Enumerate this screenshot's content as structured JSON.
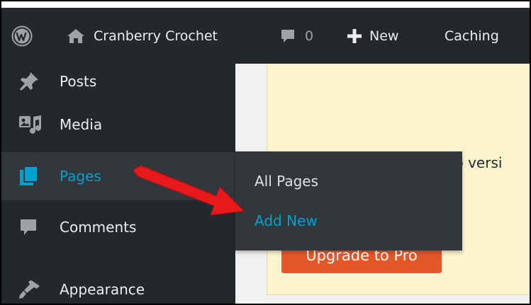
{
  "adminbar": {
    "site_name": "Cranberry Crochet",
    "comments_count": "0",
    "new_label": "New",
    "caching_label": "Caching"
  },
  "sidebar": {
    "items": [
      {
        "label": "Posts",
        "icon": "pin-icon"
      },
      {
        "label": "Media",
        "icon": "media-icon"
      },
      {
        "label": "Pages",
        "icon": "pages-icon",
        "active": true
      },
      {
        "label": "Comments",
        "icon": "comment-icon"
      },
      {
        "label": "Appearance",
        "icon": "brush-icon"
      }
    ]
  },
  "flyout": {
    "items": [
      {
        "label": "All Pages"
      },
      {
        "label": "Add New",
        "highlighted": true
      }
    ]
  },
  "notice": {
    "text": "Pro versi",
    "button_label": "Upgrade to Pro"
  },
  "colors": {
    "adminbar_bg": "#23282d",
    "submenu_bg": "#32373c",
    "link_blue": "#00a0d2",
    "notice_bg": "#fcf3cf",
    "button_orange": "#e2582a",
    "annotation_arrow": "#e8191b"
  }
}
